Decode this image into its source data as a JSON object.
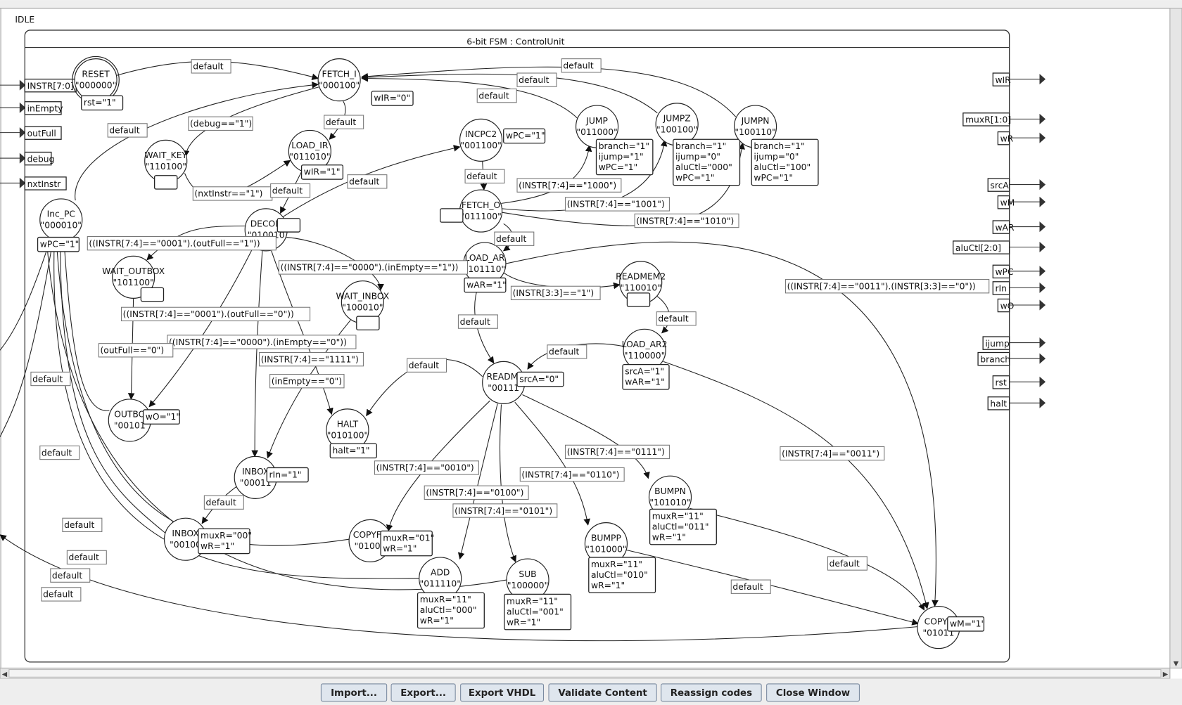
{
  "status": "IDLE",
  "fsm_title": "6-bit FSM : ControlUnit",
  "inputs": [
    "INSTR[7:0]",
    "inEmpty",
    "outFull",
    "debug",
    "nxtInstr"
  ],
  "outputs": [
    "wIR",
    "muxR[1:0]",
    "wR",
    "srcA",
    "wM",
    "wAR",
    "aluCtl[2:0]",
    "wPC",
    "rIn",
    "wO",
    "ijump",
    "branch",
    "rst",
    "halt"
  ],
  "states": [
    {
      "name": "RESET",
      "code": "\"000000\"",
      "outputs": [
        "rst=\"1\""
      ],
      "initial": true
    },
    {
      "name": "FETCH_I",
      "code": "\"000100\"",
      "outputs": [
        "wIR=\"0\""
      ]
    },
    {
      "name": "WAIT_KEY",
      "code": "\"110100\"",
      "outputs": []
    },
    {
      "name": "LOAD_IR",
      "code": "\"011010\"",
      "outputs": [
        "wIR=\"1\""
      ]
    },
    {
      "name": "INCPC2",
      "code": "\"001100\"",
      "outputs": [
        "wPC=\"1\""
      ]
    },
    {
      "name": "JUMP",
      "code": "\"011000\"",
      "outputs": [
        "branch=\"1\"",
        "ijump=\"1\"",
        "wPC=\"1\""
      ]
    },
    {
      "name": "JUMPZ",
      "code": "\"100100\"",
      "outputs": [
        "branch=\"1\"",
        "ijump=\"0\"",
        "aluCtl=\"000\"",
        "wPC=\"1\""
      ]
    },
    {
      "name": "JUMPN",
      "code": "\"100110\"",
      "outputs": [
        "branch=\"1\"",
        "ijump=\"0\"",
        "aluCtl=\"100\"",
        "wPC=\"1\""
      ]
    },
    {
      "name": "Inc_PC",
      "code": "\"000010\"",
      "outputs": [
        "wPC=\"1\""
      ]
    },
    {
      "name": "DECOD",
      "code": "\"010010",
      "outputs": []
    },
    {
      "name": "FETCH_O",
      "code": "\"011100\"",
      "outputs": []
    },
    {
      "name": "LOAD_AR",
      "code": "\"101110\"",
      "outputs": [
        "wAR=\"1\""
      ]
    },
    {
      "name": "READMEM2",
      "code": "\"110010\"",
      "outputs": []
    },
    {
      "name": "WAIT_OUTBOX",
      "code": "\"101100\"",
      "outputs": []
    },
    {
      "name": "WAIT_INBOX",
      "code": "\"100010\"",
      "outputs": []
    },
    {
      "name": "LOAD_AR2",
      "code": "\"110000\"",
      "outputs": [
        "srcA=\"1\"",
        "wAR=\"1\""
      ]
    },
    {
      "name": "READMI",
      "code": "\"00111",
      "outputs": [
        "srcA=\"0\""
      ]
    },
    {
      "name": "OUTBO",
      "code": "\"00101",
      "outputs": [
        "wO=\"1\""
      ]
    },
    {
      "name": "HALT",
      "code": "\"010100\"",
      "outputs": [
        "halt=\"1\""
      ]
    },
    {
      "name": "INBOX",
      "code": "\"00011",
      "outputs": [
        "rIn=\"1\""
      ]
    },
    {
      "name": "INBOX",
      "code": "\"00100",
      "outputs": [
        "muxR=\"00\"",
        "wR=\"1\""
      ]
    },
    {
      "name": "COPYFR",
      "code": "\"01000",
      "outputs": [
        "muxR=\"01\"",
        "wR=\"1\""
      ]
    },
    {
      "name": "ADD",
      "code": "\"011110\"",
      "outputs": [
        "muxR=\"11\"",
        "aluCtl=\"000\"",
        "wR=\"1\""
      ]
    },
    {
      "name": "SUB",
      "code": "\"100000\"",
      "outputs": [
        "muxR=\"11\"",
        "aluCtl=\"001\"",
        "wR=\"1\""
      ]
    },
    {
      "name": "BUMPP",
      "code": "\"101000\"",
      "outputs": [
        "muxR=\"11\"",
        "aluCtl=\"010\"",
        "wR=\"1\""
      ]
    },
    {
      "name": "BUMPN",
      "code": "\"101010\"",
      "outputs": [
        "muxR=\"11\"",
        "aluCtl=\"011\"",
        "wR=\"1\""
      ]
    },
    {
      "name": "COPYT",
      "code": "\"01011",
      "outputs": [
        "wM=\"1\""
      ]
    }
  ],
  "transition_labels": [
    "default",
    "default",
    "(debug==\"1\")",
    "default",
    "(nxtInstr==\"1\")",
    "default",
    "default",
    "default",
    "default",
    "default",
    "default",
    "(INSTR[7:4]==\"1000\")",
    "(INSTR[7:4]==\"1001\")",
    "(INSTR[7:4]==\"1010\")",
    "default",
    "((INSTR[7:4]==\"0001\").(outFull==\"1\"))",
    "((INSTR[7:4]==\"0000\").(inEmpty==\"1\"))",
    "(INSTR[3:3]==\"1\")",
    "((INSTR[7:4]==\"0011\").(INSTR[3:3]==\"0\"))",
    "default",
    "default",
    "((INSTR[7:4]==\"0001\").(outFull==\"0\"))",
    "((INSTR[7:4]==\"0000\").(inEmpty==\"0\"))",
    "(outFull==\"0\")",
    "(INSTR[7:4]==\"1111\")",
    "default",
    "default",
    "(inEmpty==\"0\")",
    "default",
    "default",
    "(INSTR[7:4]==\"0010\")",
    "(INSTR[7:4]==\"0111\")",
    "(INSTR[7:4]==\"0011\")",
    "(INSTR[7:4]==\"0110\")",
    "(INSTR[7:4]==\"0100\")",
    "(INSTR[7:4]==\"0101\")",
    "default",
    "default",
    "default",
    "default",
    "default",
    "default",
    "default"
  ],
  "buttons": [
    "Import...",
    "Export...",
    "Export VHDL",
    "Validate Content",
    "Reassign codes",
    "Close Window"
  ]
}
